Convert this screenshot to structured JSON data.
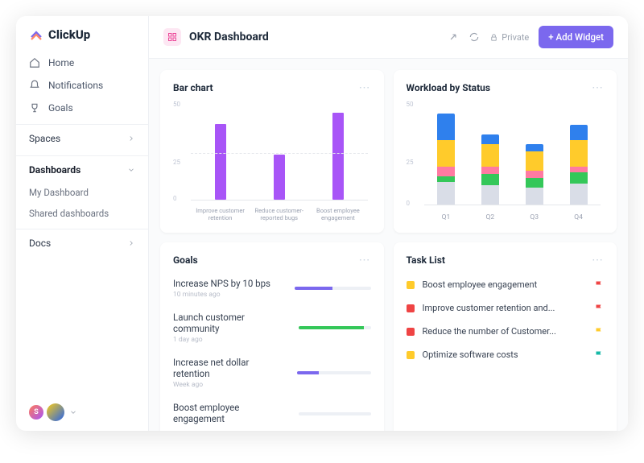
{
  "brand": "ClickUp",
  "nav": {
    "home": "Home",
    "notifications": "Notifications",
    "goals": "Goals"
  },
  "sections": {
    "spaces": "Spaces",
    "dashboards": "Dashboards",
    "docs": "Docs"
  },
  "dashboards_children": {
    "my": "My Dashboard",
    "shared": "Shared dashboards"
  },
  "header": {
    "title": "OKR Dashboard",
    "private": "Private",
    "add_widget": "+ Add Widget"
  },
  "avatar_letter": "S",
  "cards": {
    "bar": {
      "title": "Bar chart"
    },
    "workload": {
      "title": "Workload by Status"
    },
    "goals": {
      "title": "Goals"
    },
    "tasks": {
      "title": "Task List"
    }
  },
  "chart_data": [
    {
      "id": "bar",
      "type": "bar",
      "title": "Bar chart",
      "ylim": [
        0,
        50
      ],
      "yticks": [
        "0",
        "25",
        "50"
      ],
      "categories": [
        "Improve customer retention",
        "Reduce customer-reported bugs",
        "Boost employee engagement"
      ],
      "values": [
        40,
        24,
        46
      ],
      "color": "#a855f7"
    },
    {
      "id": "workload",
      "type": "stacked-bar",
      "title": "Workload by Status",
      "ylim": [
        0,
        50
      ],
      "yticks": [
        "0",
        "25",
        "50"
      ],
      "categories": [
        "Q1",
        "Q2",
        "Q3",
        "Q4"
      ],
      "series": [
        {
          "name": "gray",
          "color": "#d9dde7",
          "values": [
            12,
            10,
            9,
            11
          ]
        },
        {
          "name": "green",
          "color": "#34c759",
          "values": [
            3,
            6,
            5,
            6
          ]
        },
        {
          "name": "pink",
          "color": "#ff7aa2",
          "values": [
            5,
            4,
            4,
            3
          ]
        },
        {
          "name": "yellow",
          "color": "#ffcb2b",
          "values": [
            14,
            12,
            10,
            14
          ]
        },
        {
          "name": "blue",
          "color": "#2f80ed",
          "values": [
            14,
            5,
            4,
            8
          ]
        }
      ]
    }
  ],
  "goals": [
    {
      "name": "Increase NPS by 10 bps",
      "meta": "10 minutes ago",
      "pct": 50,
      "color": "#7b68ee"
    },
    {
      "name": "Launch customer community",
      "meta": "1 day ago",
      "pct": 90,
      "color": "#34c759"
    },
    {
      "name": "Increase net dollar retention",
      "meta": "Week ago",
      "pct": 30,
      "color": "#7b68ee"
    },
    {
      "name": "Boost employee engagement",
      "meta": "",
      "pct": 0,
      "color": "#7b68ee"
    }
  ],
  "tasks": [
    {
      "sq": "#ffcb2b",
      "name": "Boost employee engagement",
      "flag": "#ef4444"
    },
    {
      "sq": "#ef4444",
      "name": "Improve customer retention and...",
      "flag": "#ef4444"
    },
    {
      "sq": "#ef4444",
      "name": "Reduce the number of Customer...",
      "flag": "#ffcb2b"
    },
    {
      "sq": "#ffcb2b",
      "name": "Optimize software costs",
      "flag": "#14b8a6"
    }
  ]
}
